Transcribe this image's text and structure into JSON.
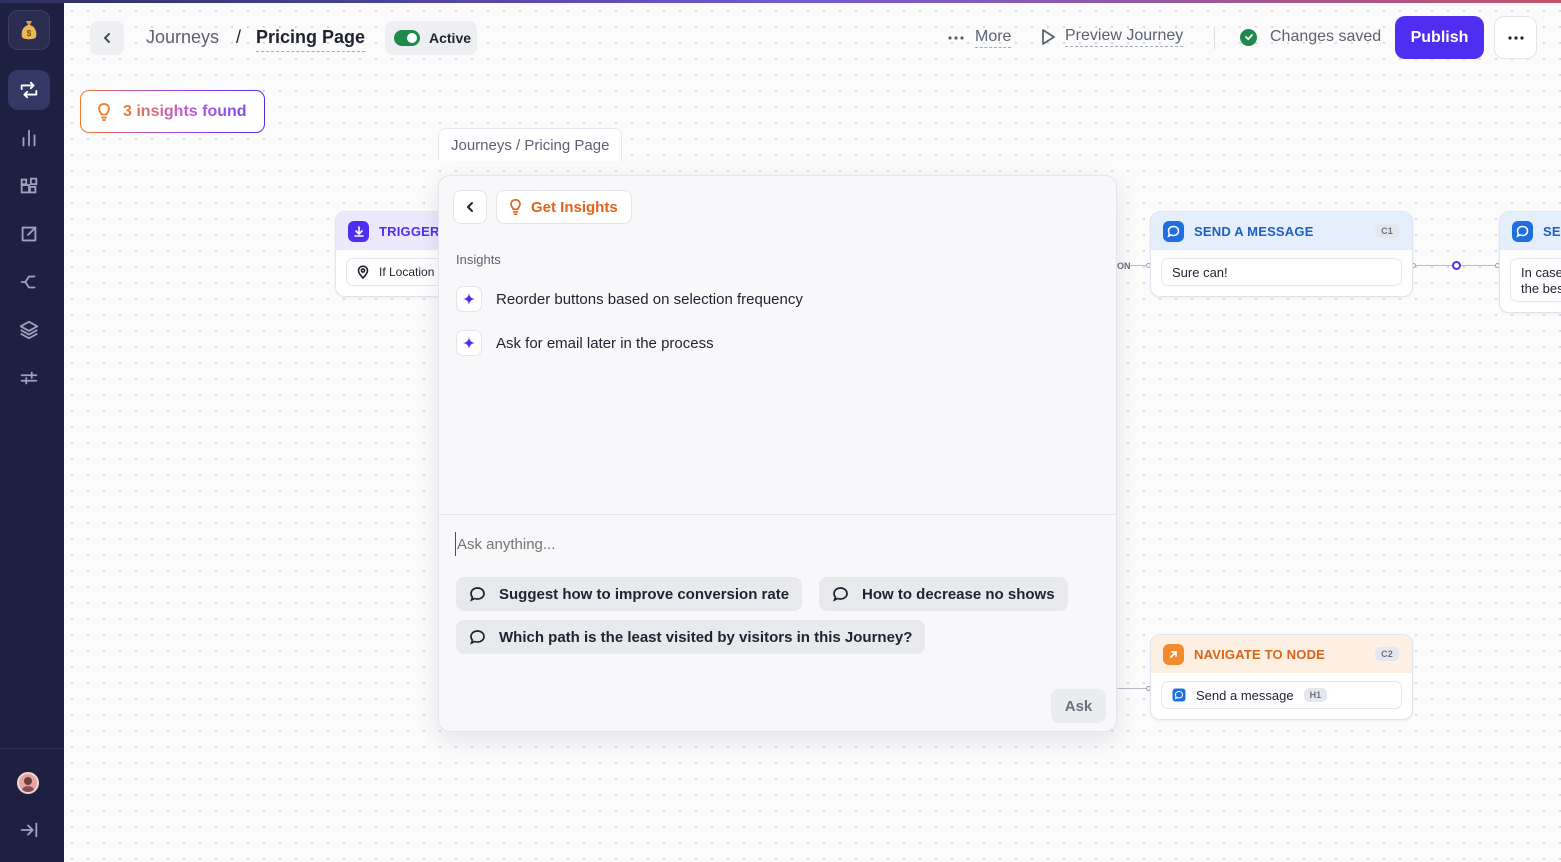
{
  "breadcrumb": {
    "parent": "Journeys",
    "separator": "/",
    "current": "Pricing Page"
  },
  "status": {
    "label": "Active",
    "on": true
  },
  "header": {
    "more_label": "More",
    "preview_label": "Preview Journey",
    "saved_label": "Changes saved",
    "publish_label": "Publish"
  },
  "sidebar": {
    "items": [
      {
        "icon": "journeys-icon",
        "active": true
      },
      {
        "icon": "analytics-icon",
        "active": false
      },
      {
        "icon": "widgets-icon",
        "active": false
      },
      {
        "icon": "integrations-icon",
        "active": false
      },
      {
        "icon": "branch-icon",
        "active": false
      },
      {
        "icon": "layers-icon",
        "active": false
      },
      {
        "icon": "settings-sliders-icon",
        "active": false
      }
    ],
    "bottom": [
      "avatar",
      "collapse-icon"
    ]
  },
  "insights_badge": {
    "label": "3 insights found"
  },
  "panel": {
    "crumb": "Journeys / Pricing Page",
    "title": "Get Insights",
    "section_label": "Insights",
    "insights": [
      "Reorder buttons based on selection frequency",
      "Ask for email later in the process"
    ],
    "input_placeholder": "Ask anything...",
    "suggestions": [
      "Suggest how to improve conversion rate",
      "How to decrease no shows",
      "Which path is the least visited by visitors in this Journey?"
    ],
    "ask_label": "Ask"
  },
  "nodes": {
    "trigger": {
      "title": "TRIGGER",
      "field": "If Location"
    },
    "send1": {
      "title": "SEND A MESSAGE",
      "badge": "C1",
      "field": "Sure can!"
    },
    "send2": {
      "title": "SE",
      "field_line1": "In case",
      "field_line2": "the bes"
    },
    "nav": {
      "title": "NAVIGATE TO NODE",
      "badge": "C2",
      "field": "Send a message",
      "field_badge": "H1"
    },
    "edge_label": "ON"
  },
  "colors": {
    "accent": "#4f2ef2",
    "orange": "#e3641b",
    "success": "#1f8a4c",
    "sidebar": "#1d2040"
  }
}
